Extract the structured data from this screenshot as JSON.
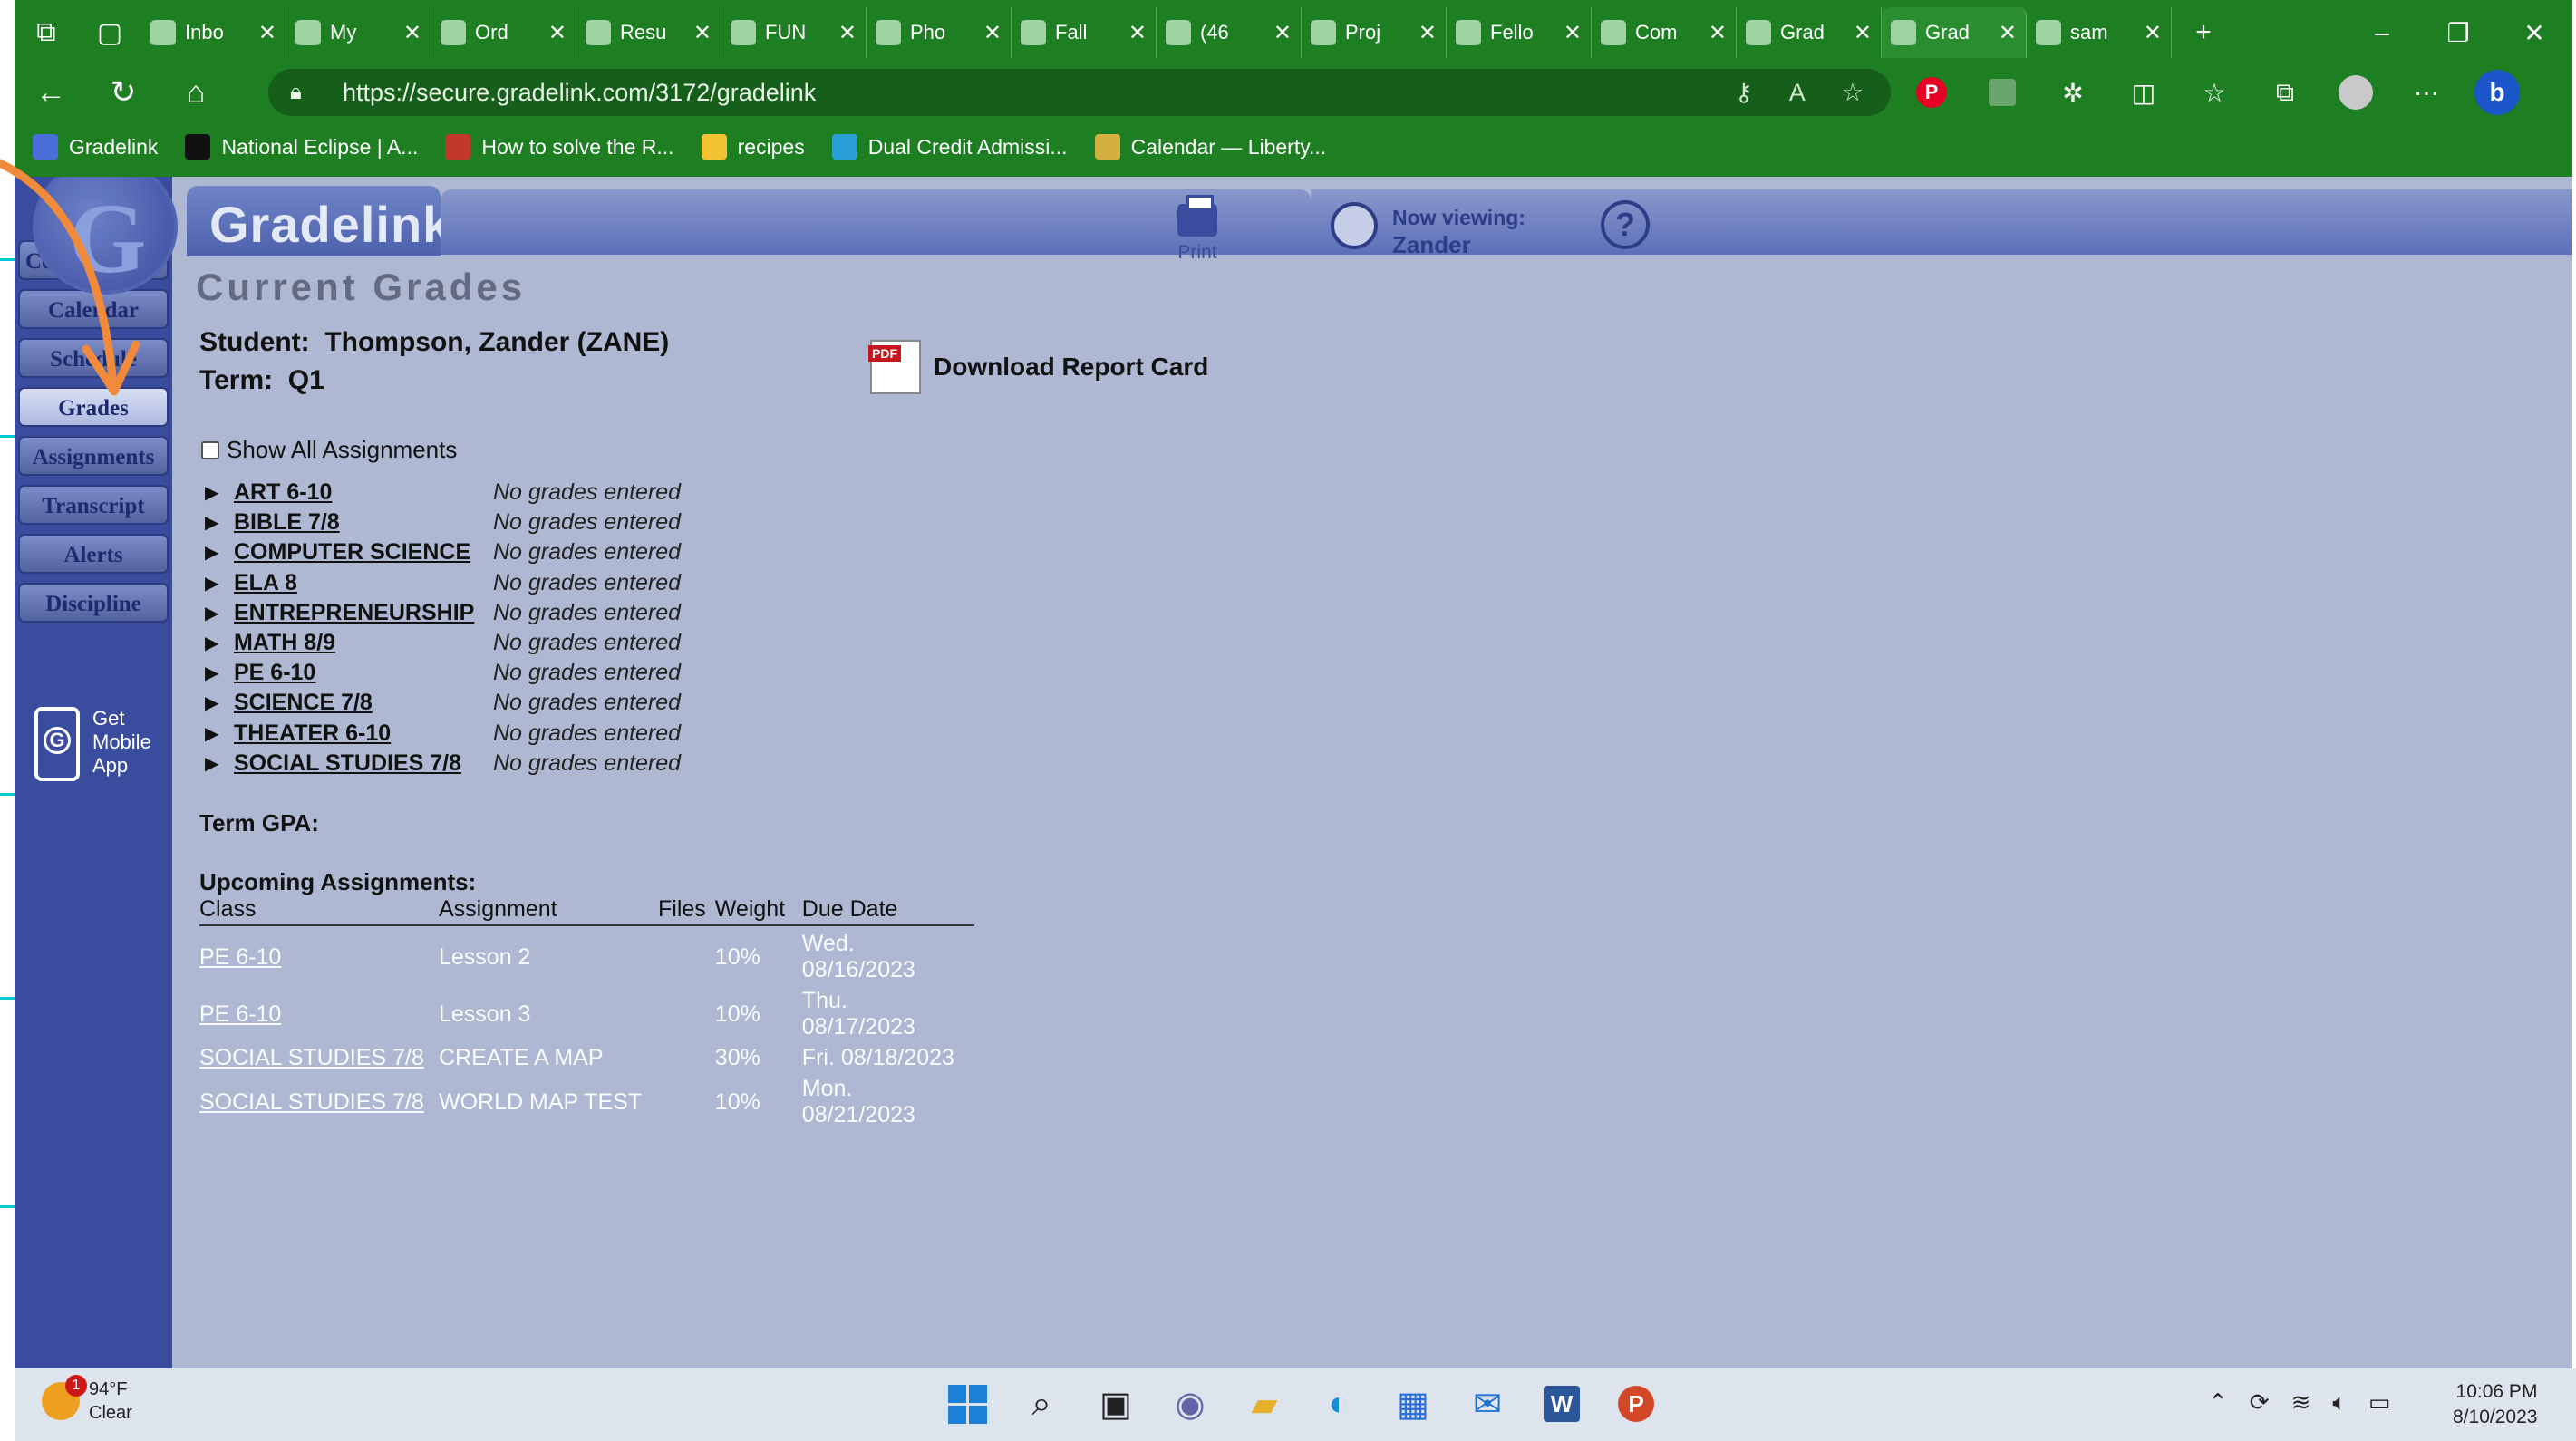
{
  "browser": {
    "tabs": [
      {
        "icon": "gmail-icon",
        "title": "Inbo"
      },
      {
        "icon": "drive-icon",
        "title": "My"
      },
      {
        "icon": "bnc-icon",
        "title": "Ord"
      },
      {
        "icon": "sheet-icon",
        "title": "Resu"
      },
      {
        "icon": "sheet-icon",
        "title": "FUN"
      },
      {
        "icon": "sheet-icon",
        "title": "Pho"
      },
      {
        "icon": "sheet-icon",
        "title": "Fall"
      },
      {
        "icon": "yahoo-icon",
        "title": "(46"
      },
      {
        "icon": "c-icon",
        "title": "Proj"
      },
      {
        "icon": "shield-icon",
        "title": "Fello"
      },
      {
        "icon": "shield-icon",
        "title": "Com"
      },
      {
        "icon": "gradelink-icon",
        "title": "Grad"
      },
      {
        "icon": "gradelink-icon",
        "title": "Grad"
      },
      {
        "icon": "pdf-icon",
        "title": "sam"
      }
    ],
    "url": "https://secure.gradelink.com/3172/gradelink",
    "bookmarks": [
      {
        "icon": "gradelink-icon",
        "label": "Gradelink"
      },
      {
        "icon": "star-icon",
        "label": "National Eclipse | A..."
      },
      {
        "icon": "video-icon",
        "label": "How to solve the R..."
      },
      {
        "icon": "folder-icon",
        "label": "recipes"
      },
      {
        "icon": "plane-icon",
        "label": "Dual Credit Admissi..."
      },
      {
        "icon": "calendar-icon",
        "label": "Calendar — Liberty..."
      }
    ]
  },
  "app": {
    "logo": "Gradelink",
    "print_label": "Print",
    "viewing_label": "Now viewing:",
    "viewing_name": "Zander",
    "help_symbol": "?"
  },
  "sidebar": {
    "items": [
      {
        "label": "Communicate",
        "active": false
      },
      {
        "label": "Calendar",
        "active": false
      },
      {
        "label": "Schedule",
        "active": false
      },
      {
        "label": "Grades",
        "active": true
      },
      {
        "label": "Assignments",
        "active": false
      },
      {
        "label": "Transcript",
        "active": false
      },
      {
        "label": "Alerts",
        "active": false
      },
      {
        "label": "Discipline",
        "active": false
      }
    ],
    "mobile_app": {
      "line1": "Get",
      "line2": "Mobile",
      "line3": "App"
    }
  },
  "main": {
    "title": "Current Grades",
    "student_label": "Student:",
    "student_name": "Thompson, Zander (ZANE)",
    "term_label": "Term:",
    "term_value": "Q1",
    "download_label": "Download Report Card",
    "pdf_badge": "PDF",
    "show_all_label": "Show All Assignments",
    "classes": [
      {
        "name": "ART 6-10",
        "status": "No grades entered"
      },
      {
        "name": "BIBLE 7/8",
        "status": "No grades entered"
      },
      {
        "name": "COMPUTER SCIENCE",
        "status": "No grades entered"
      },
      {
        "name": "ELA 8",
        "status": "No grades entered"
      },
      {
        "name": "ENTREPRENEURSHIP",
        "status": "No grades entered"
      },
      {
        "name": "MATH 8/9",
        "status": "No grades entered"
      },
      {
        "name": "PE 6-10",
        "status": "No grades entered"
      },
      {
        "name": "SCIENCE 7/8",
        "status": "No grades entered"
      },
      {
        "name": "THEATER 6-10",
        "status": "No grades entered"
      },
      {
        "name": "SOCIAL STUDIES 7/8",
        "status": "No grades entered"
      }
    ],
    "gpa_label": "Term GPA:",
    "upcoming_title": "Upcoming Assignments:",
    "upcoming_headers": [
      "Class",
      "Assignment",
      "Files",
      "Weight",
      "Due Date"
    ],
    "upcoming_rows": [
      [
        "PE 6-10",
        "Lesson 2",
        "",
        "10%",
        "Wed. 08/16/2023"
      ],
      [
        "PE 6-10",
        "Lesson 3",
        "",
        "10%",
        "Thu. 08/17/2023"
      ],
      [
        "SOCIAL STUDIES 7/8",
        "CREATE A MAP",
        "",
        "30%",
        "Fri. 08/18/2023"
      ],
      [
        "SOCIAL STUDIES 7/8",
        "WORLD MAP TEST",
        "",
        "10%",
        "Mon. 08/21/2023"
      ]
    ]
  },
  "taskbar": {
    "weather_temp": "94°F",
    "weather_desc": "Clear",
    "weather_badge": "1",
    "time": "10:06 PM",
    "date": "8/10/2023",
    "icons": [
      "windows-start-icon",
      "search-icon",
      "task-view-icon",
      "chat-icon",
      "file-explorer-icon",
      "edge-icon",
      "store-icon",
      "mail-icon",
      "word-icon",
      "powerpoint-icon"
    ]
  },
  "colors": {
    "browser_green": "#1d7e22",
    "page_bg": "#aeb8d2",
    "sidebar_blue": "#3a4c9e",
    "annotation_orange": "#f28a3c"
  }
}
